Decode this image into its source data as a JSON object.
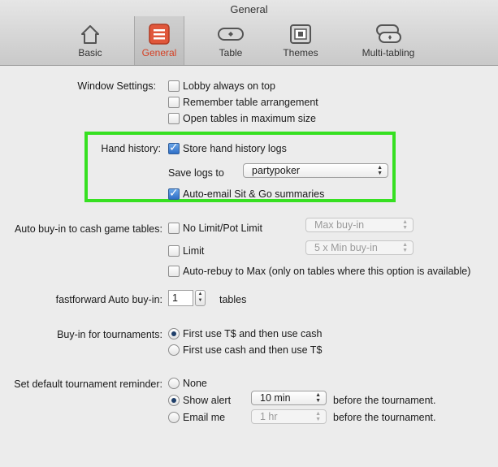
{
  "window": {
    "title": "General"
  },
  "toolbar": {
    "items": [
      {
        "label": "Basic",
        "icon": "house-icon"
      },
      {
        "label": "General",
        "icon": "list-icon",
        "selected": true
      },
      {
        "label": "Table",
        "icon": "table-icon"
      },
      {
        "label": "Themes",
        "icon": "themes-icon"
      },
      {
        "label": "Multi-tabling",
        "icon": "multitable-icon"
      }
    ],
    "selected_color": "#d53f22"
  },
  "window_settings": {
    "label": "Window Settings:",
    "options": [
      {
        "label": "Lobby always on top",
        "checked": false
      },
      {
        "label": "Remember table arrangement",
        "checked": false
      },
      {
        "label": "Open tables in maximum size",
        "checked": false
      }
    ]
  },
  "hand_history": {
    "label": "Hand history:",
    "store_logs": {
      "label": "Store hand history logs",
      "checked": true
    },
    "save_logs_label": "Save logs to",
    "save_logs_value": "partypoker",
    "auto_email": {
      "label": "Auto-email Sit & Go summaries",
      "checked": true
    },
    "highlight_color": "#36e021"
  },
  "auto_buyin": {
    "label": "Auto buy-in to cash game tables:",
    "no_limit": {
      "label": "No Limit/Pot Limit",
      "checked": false,
      "select_value": "Max buy-in"
    },
    "limit": {
      "label": "Limit",
      "checked": false,
      "select_value": "5 x Min buy-in"
    },
    "auto_rebuy": {
      "label": "Auto-rebuy to Max (only on tables where this option is available)",
      "checked": false
    }
  },
  "fastforward": {
    "label": "fastforward Auto buy-in:",
    "value": "1",
    "suffix": "tables"
  },
  "tournament_buyin": {
    "label": "Buy-in for tournaments:",
    "options": [
      {
        "label": "First use T$ and then use cash",
        "selected": true
      },
      {
        "label": "First use cash and then use T$",
        "selected": false
      }
    ]
  },
  "reminder": {
    "label": "Set default tournament reminder:",
    "none": {
      "label": "None",
      "selected": false
    },
    "show_alert": {
      "label": "Show alert",
      "selected": true,
      "select_value": "10 min",
      "suffix": "before the tournament."
    },
    "email_me": {
      "label": "Email me",
      "selected": false,
      "select_value": "1 hr",
      "suffix": "before the tournament."
    }
  }
}
